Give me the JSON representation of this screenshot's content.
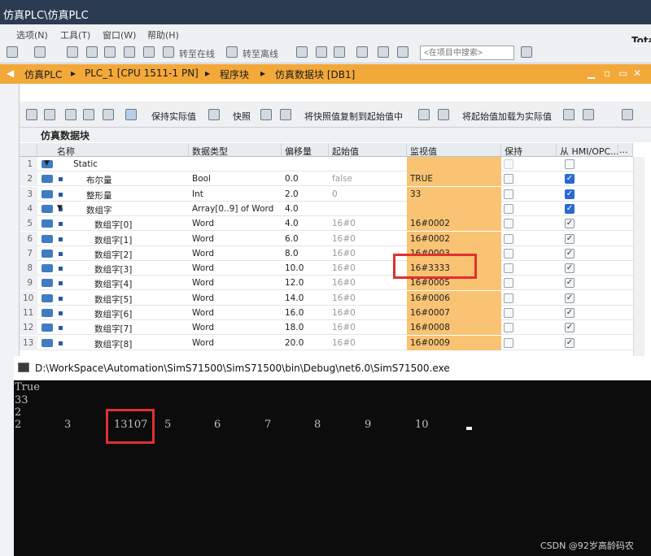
{
  "window": {
    "title": "仿真PLC\\仿真PLC",
    "right_text": "Tota"
  },
  "menu": [
    "选项(N)",
    "工具(T)",
    "窗口(W)",
    "帮助(H)"
  ],
  "toolbar": {
    "go_online": "转至在线",
    "go_offline": "转至离线",
    "search_placeholder": "<在项目中搜索>"
  },
  "breadcrumb": [
    "仿真PLC",
    "PLC_1 [CPU 1511-1 PN]",
    "程序块",
    "仿真数据块 [DB1]"
  ],
  "editor_toolbar": {
    "keep_actual": "保持实际值",
    "snapshot": "快照",
    "copy_snapshot": "将快照值复制到起始值中",
    "load_start": "将起始值加载为实际值"
  },
  "block_title": "仿真数据块",
  "columns": [
    "名称",
    "数据类型",
    "偏移量",
    "起始值",
    "监视值",
    "保持",
    "从 HMI/OPC...",
    "..."
  ],
  "rows": [
    {
      "num": "1",
      "name": "Static",
      "type": "",
      "offset": "",
      "start": "",
      "monitor": "",
      "level": 0,
      "expand": true,
      "hmi": "none"
    },
    {
      "num": "2",
      "name": "布尔量",
      "type": "Bool",
      "offset": "0.0",
      "start": "false",
      "monitor": "TRUE",
      "level": 1,
      "expand": false,
      "hmi": "checked"
    },
    {
      "num": "3",
      "name": "整形量",
      "type": "Int",
      "offset": "2.0",
      "start": "0",
      "monitor": "33",
      "level": 1,
      "expand": false,
      "hmi": "checked"
    },
    {
      "num": "4",
      "name": "数组字",
      "type": "Array[0..9] of Word",
      "offset": "4.0",
      "start": "",
      "monitor": "",
      "level": 1,
      "expand": true,
      "hmi": "checked"
    },
    {
      "num": "5",
      "name": "数组字[0]",
      "type": "Word",
      "offset": "4.0",
      "start": "16#0",
      "monitor": "16#0002",
      "level": 2,
      "expand": false,
      "hmi": "gray"
    },
    {
      "num": "6",
      "name": "数组字[1]",
      "type": "Word",
      "offset": "6.0",
      "start": "16#0",
      "monitor": "16#0002",
      "level": 2,
      "expand": false,
      "hmi": "gray"
    },
    {
      "num": "7",
      "name": "数组字[2]",
      "type": "Word",
      "offset": "8.0",
      "start": "16#0",
      "monitor": "16#0003",
      "level": 2,
      "expand": false,
      "hmi": "gray"
    },
    {
      "num": "8",
      "name": "数组字[3]",
      "type": "Word",
      "offset": "10.0",
      "start": "16#0",
      "monitor": "16#3333",
      "level": 2,
      "expand": false,
      "hmi": "gray"
    },
    {
      "num": "9",
      "name": "数组字[4]",
      "type": "Word",
      "offset": "12.0",
      "start": "16#0",
      "monitor": "16#0005",
      "level": 2,
      "expand": false,
      "hmi": "gray"
    },
    {
      "num": "10",
      "name": "数组字[5]",
      "type": "Word",
      "offset": "14.0",
      "start": "16#0",
      "monitor": "16#0006",
      "level": 2,
      "expand": false,
      "hmi": "gray"
    },
    {
      "num": "11",
      "name": "数组字[6]",
      "type": "Word",
      "offset": "16.0",
      "start": "16#0",
      "monitor": "16#0007",
      "level": 2,
      "expand": false,
      "hmi": "gray"
    },
    {
      "num": "12",
      "name": "数组字[7]",
      "type": "Word",
      "offset": "18.0",
      "start": "16#0",
      "monitor": "16#0008",
      "level": 2,
      "expand": false,
      "hmi": "gray"
    },
    {
      "num": "13",
      "name": "数组字[8]",
      "type": "Word",
      "offset": "20.0",
      "start": "16#0",
      "monitor": "16#0009",
      "level": 2,
      "expand": false,
      "hmi": "gray"
    }
  ],
  "console": {
    "title": "D:\\WorkSpace\\Automation\\SimS71500\\SimS71500\\bin\\Debug\\net6.0\\SimS71500.exe",
    "lines": [
      "True",
      "33",
      "2"
    ],
    "array_values": [
      "2",
      "3",
      "13107",
      "5",
      "6",
      "7",
      "8",
      "9",
      "10"
    ]
  },
  "watermark": "CSDN @92岁高龄码农",
  "colors": {
    "breadcrumb_bar": "#f3a83a",
    "monitor_cell": "#f9c373",
    "highlight_box": "#e03030",
    "console_bg": "#0c0c0c"
  }
}
